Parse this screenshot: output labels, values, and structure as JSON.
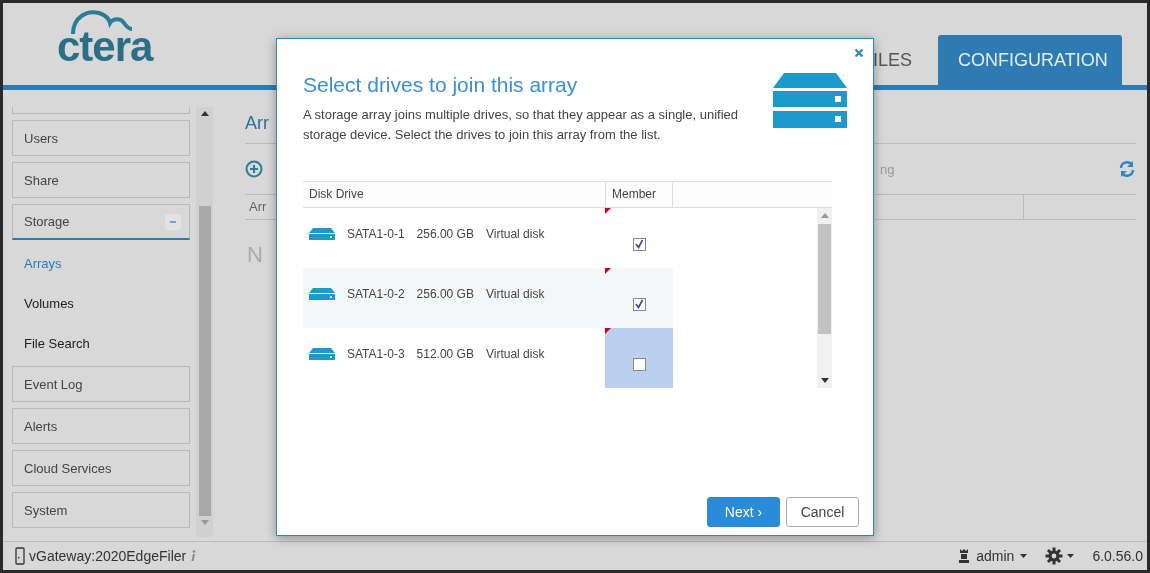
{
  "header": {
    "logo": "ctera",
    "tabs": [
      {
        "label": "ILES",
        "selected": false
      },
      {
        "label": "CONFIGURATION",
        "selected": true
      }
    ]
  },
  "sidebar": {
    "items": [
      {
        "label": "Users"
      },
      {
        "label": "Share"
      },
      {
        "label": "Storage",
        "expanded": true,
        "children": [
          {
            "label": "Arrays",
            "selected": true
          },
          {
            "label": "Volumes",
            "selected": false
          },
          {
            "label": "File Search",
            "selected": false
          }
        ]
      },
      {
        "label": "Event Log"
      },
      {
        "label": "Alerts"
      },
      {
        "label": "Cloud Services"
      },
      {
        "label": "System"
      }
    ]
  },
  "content": {
    "title": "Arr",
    "toolbar_text": "ng",
    "table": {
      "columns": [
        "Arr"
      ]
    },
    "empty_text": "N"
  },
  "dialog": {
    "title": "Select drives to join this array",
    "description": "A storage array joins multiple drives, so that they appear as a single, unified storage device. Select the drives to join this array from the list.",
    "columns": [
      "Disk Drive",
      "Member"
    ],
    "rows": [
      {
        "name": "SATA1-0-1",
        "size": "256.00 GB",
        "type": "Virtual disk",
        "checked": true,
        "selected": false
      },
      {
        "name": "SATA1-0-2",
        "size": "256.00 GB",
        "type": "Virtual disk",
        "checked": true,
        "selected": false
      },
      {
        "name": "SATA1-0-3",
        "size": "512.00 GB",
        "type": "Virtual disk",
        "checked": false,
        "selected": true
      }
    ],
    "buttons": [
      {
        "label": "Next ›",
        "kind": "primary"
      },
      {
        "label": "Cancel",
        "kind": "secondary"
      }
    ]
  },
  "status_bar": {
    "device": "vGateway:2020EdgeFiler",
    "user": "admin",
    "version": "6.0.56.0"
  }
}
